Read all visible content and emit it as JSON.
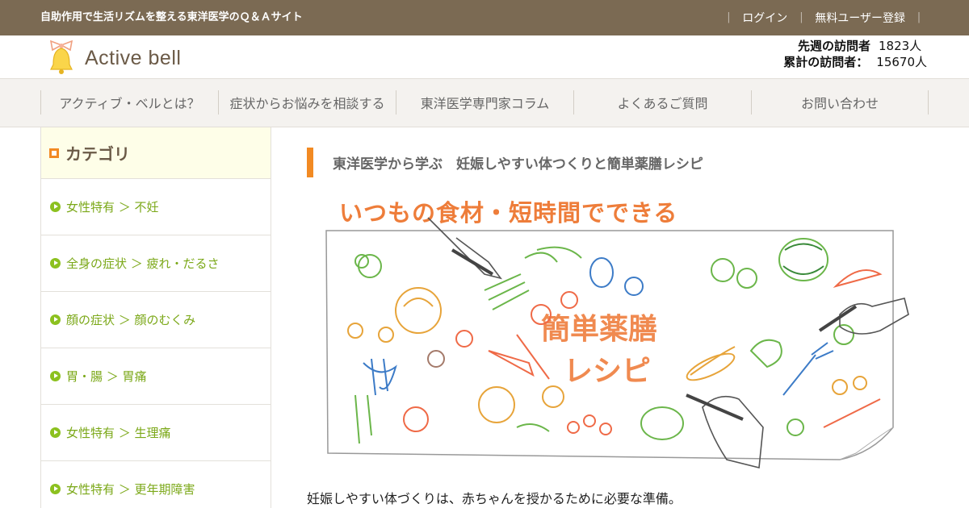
{
  "topbar": {
    "tagline": "自助作用で生活リズムを整える東洋医学のＱ＆Ａサイト",
    "login": "ログイン",
    "register": "無料ユーザー登録",
    "separator": "｜"
  },
  "header": {
    "logo_text": "Active bell",
    "last_week_label": "先週の訪問者",
    "last_week_value": "1823人",
    "total_label": "累計の訪問者：",
    "total_value": "15670人"
  },
  "nav": {
    "items": [
      "アクティブ・ベルとは？",
      "症状からお悩みを相談する",
      "東洋医学専門家コラム",
      "よくあるご質問",
      "お問い合わせ"
    ]
  },
  "sidebar": {
    "title": "カテゴリ",
    "items": [
      "女性特有 ＞ 不妊",
      "全身の症状 ＞ 疲れ・だるさ",
      "顔の症状 ＞ 顔のむくみ",
      "胃・腸 ＞ 胃痛",
      "女性特有 ＞ 生理痛",
      "女性特有 ＞ 更年期障害"
    ]
  },
  "main": {
    "title": "東洋医学から学ぶ　妊娠しやすい体つくりと簡単薬膳レシピ",
    "hero_heading": "いつもの食材・短時間でできる",
    "hero_line1": "簡単薬膳",
    "hero_line2": "レシピ",
    "intro": "妊娠しやすい体づくりは、赤ちゃんを授かるために必要な準備。"
  },
  "colors": {
    "topbar": "#7b6a53",
    "accent_orange": "#f28a23",
    "category_green": "#8cc11f"
  }
}
